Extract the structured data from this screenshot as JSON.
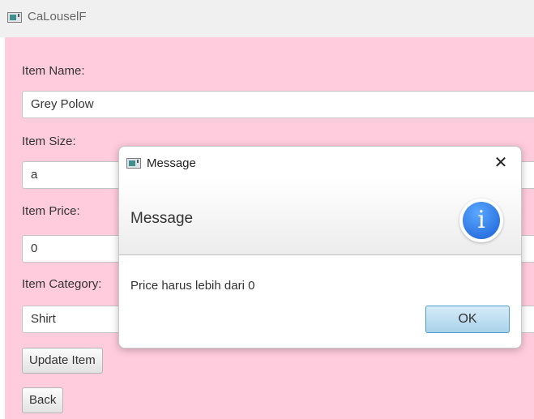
{
  "window": {
    "title": "CaLouselF",
    "icon": "app-window-icon"
  },
  "form": {
    "name_label": "Item Name:",
    "name_value": "Grey Polow",
    "size_label": "Item Size:",
    "size_value": "a",
    "price_label": "Item Price:",
    "price_value": "0",
    "category_label": "Item Category:",
    "category_value": "Shirt",
    "update_button": "Update Item",
    "back_button": "Back"
  },
  "dialog": {
    "title": "Message",
    "close_glyph": "✕",
    "header": "Message",
    "info_glyph": "i",
    "body": "Price harus lebih dari 0",
    "ok_button": "OK"
  },
  "colors": {
    "content_background": "#ffccdd",
    "ok_button_border": "#4a9bd0",
    "info_icon": "#2f7fe8"
  }
}
